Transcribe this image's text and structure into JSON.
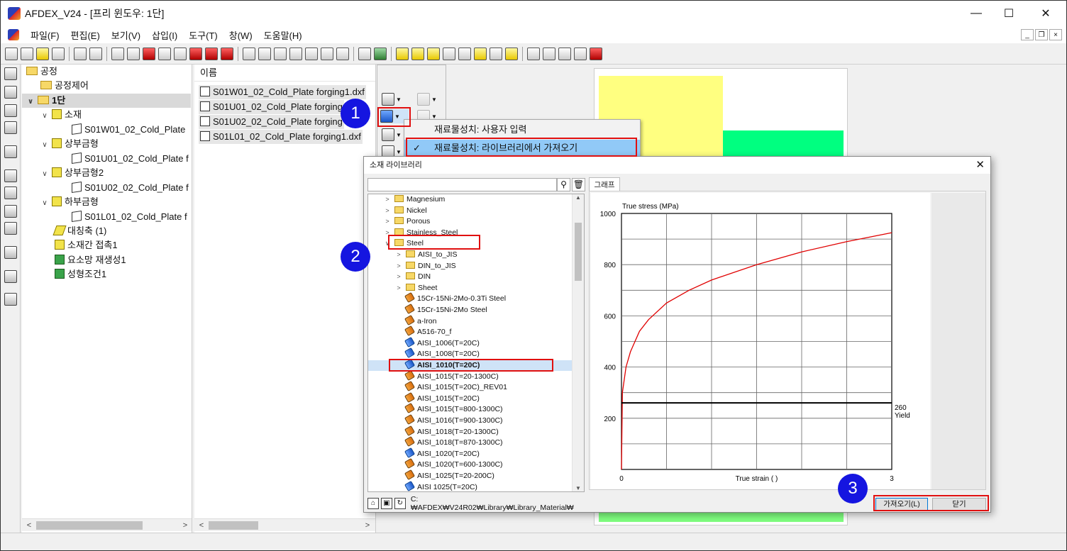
{
  "window": {
    "title": "AFDEX_V24 - [프리 윈도우: 1단]"
  },
  "menu": [
    "파일(F)",
    "편집(E)",
    "보기(V)",
    "삽입(I)",
    "도구(T)",
    "창(W)",
    "도움말(H)"
  ],
  "process_tree": {
    "root": "공정",
    "control": "공정제어",
    "stage": "1단",
    "material": "소재",
    "material_file": "S01W01_02_Cold_Plate",
    "upper_die": "상부금형",
    "upper_die_file": "S01U01_02_Cold_Plate f",
    "upper_die2": "상부금형2",
    "upper_die2_file": "S01U02_02_Cold_Plate f",
    "lower_die": "하부금형",
    "lower_die_file": "S01L01_02_Cold_Plate f",
    "symmetry": "대칭축 (1)",
    "contact": "소재간 접촉1",
    "remesh": "요소망 재생성1",
    "conditions": "성형조건1"
  },
  "file_list": {
    "header": "이름",
    "files": [
      "S01W01_02_Cold_Plate forging1.dxf",
      "S01U01_02_Cold_Plate forging",
      "S01U02_02_Cold_Plate forging",
      "S01L01_02_Cold_Plate forging1.dxf"
    ]
  },
  "dropdown": {
    "item_user": "재료물성치: 사용자 입력",
    "item_library": "재료물성치: 라이브러리에서 가져오기",
    "checkmark": "✓"
  },
  "dialog": {
    "title": "소재 라이브러리",
    "close": "✕",
    "tab": "그래프",
    "path": "C:₩AFDEX₩V24R02₩Library₩Library_Material₩",
    "import_button": "가져오기(L)",
    "close_button": "닫기"
  },
  "library_tree": [
    {
      "label": "Magnesium",
      "kind": "folder",
      "level": 0,
      "expander": ">"
    },
    {
      "label": "Nickel",
      "kind": "folder",
      "level": 0,
      "expander": ">"
    },
    {
      "label": "Porous",
      "kind": "folder",
      "level": 0,
      "expander": ">"
    },
    {
      "label": "Stainless_Steel",
      "kind": "folder",
      "level": 0,
      "expander": ">"
    },
    {
      "label": "Steel",
      "kind": "folder-open",
      "level": 0,
      "expander": "v"
    },
    {
      "label": "AISI_to_JIS",
      "kind": "folder",
      "level": 1,
      "expander": ">"
    },
    {
      "label": "DIN_to_JIS",
      "kind": "folder",
      "level": 1,
      "expander": ">"
    },
    {
      "label": "DIN",
      "kind": "folder",
      "level": 1,
      "expander": ">"
    },
    {
      "label": "Sheet",
      "kind": "folder",
      "level": 1,
      "expander": ">"
    },
    {
      "label": "15Cr-15Ni-2Mo-0.3Ti Steel",
      "kind": "orange",
      "level": 1
    },
    {
      "label": "15Cr-15Ni-2Mo Steel",
      "kind": "orange",
      "level": 1
    },
    {
      "label": "a-Iron",
      "kind": "orange",
      "level": 1
    },
    {
      "label": "A516-70_f",
      "kind": "orange",
      "level": 1
    },
    {
      "label": "AISI_1006(T=20C)",
      "kind": "blue",
      "level": 1
    },
    {
      "label": "AISI_1008(T=20C)",
      "kind": "blue",
      "level": 1
    },
    {
      "label": "AISI_1010(T=20C)",
      "kind": "blue",
      "level": 1,
      "selected": true
    },
    {
      "label": "AISI_1015(T=20-1300C)",
      "kind": "orange",
      "level": 1
    },
    {
      "label": "AISI_1015(T=20C)_REV01",
      "kind": "orange",
      "level": 1
    },
    {
      "label": "AISI_1015(T=20C)",
      "kind": "orange",
      "level": 1
    },
    {
      "label": "AISI_1015(T=800-1300C)",
      "kind": "orange",
      "level": 1
    },
    {
      "label": "AISI_1016(T=900-1300C)",
      "kind": "orange",
      "level": 1
    },
    {
      "label": "AISI_1018(T=20-1300C)",
      "kind": "orange",
      "level": 1
    },
    {
      "label": "AISI_1018(T=870-1300C)",
      "kind": "orange",
      "level": 1
    },
    {
      "label": "AISI_1020(T=20C)",
      "kind": "blue",
      "level": 1
    },
    {
      "label": "AISI_1020(T=600-1300C)",
      "kind": "orange",
      "level": 1
    },
    {
      "label": "AISI_1025(T=20-200C)",
      "kind": "orange",
      "level": 1
    },
    {
      "label": "AISI 1025(T=20C)",
      "kind": "blue",
      "level": 1
    }
  ],
  "badges": [
    "1",
    "2",
    "3"
  ],
  "chart_data": {
    "type": "line",
    "ylabel": "True stress (MPa)",
    "xlabel": "True strain (  )",
    "xlim": [
      0,
      3
    ],
    "ylim": [
      0,
      1000
    ],
    "x_ticks": [
      "0",
      "3"
    ],
    "y_ticks": [
      "200",
      "400",
      "600",
      "800",
      "1000"
    ],
    "grid": true,
    "series": [
      {
        "color": "#e00000",
        "x": [
          0,
          0.01,
          0.05,
          0.1,
          0.2,
          0.3,
          0.5,
          0.75,
          1.0,
          1.5,
          2.0,
          2.5,
          3.0
        ],
        "y": [
          0,
          300,
          400,
          460,
          540,
          585,
          650,
          700,
          740,
          800,
          850,
          890,
          925
        ]
      },
      {
        "color": "#000000",
        "x": [
          0,
          3
        ],
        "y": [
          260,
          260
        ]
      }
    ],
    "annotation": {
      "value": "260",
      "label": "Yield"
    }
  },
  "colors": {
    "highlight_red": "#e01010",
    "badge_blue": "#1515e0",
    "selection_blue": "#91c9f7",
    "viewport_yellow": "#ffff80",
    "viewport_green": "#00ff80"
  }
}
